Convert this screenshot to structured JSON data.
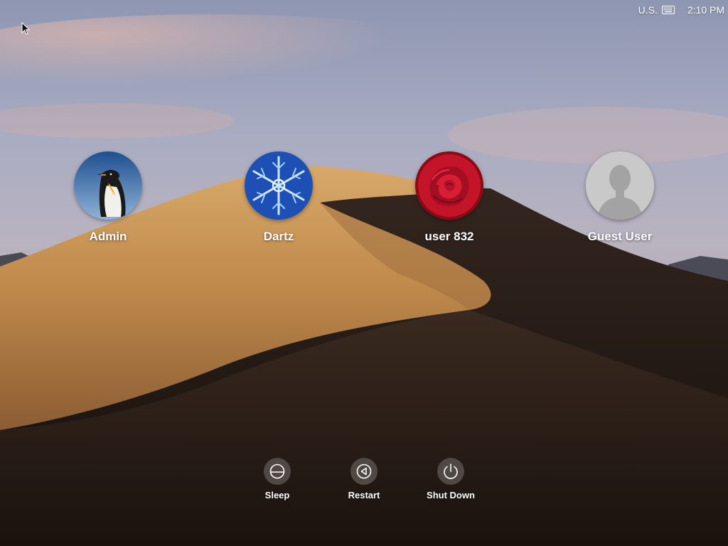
{
  "menubar": {
    "input_source": "U.S.",
    "input_source_icon": "keyboard-icon",
    "clock": "2:10 PM"
  },
  "users": [
    {
      "name": "Admin",
      "avatar": "penguin-avatar"
    },
    {
      "name": "Dartz",
      "avatar": "snowflake-avatar"
    },
    {
      "name": "user 832",
      "avatar": "rose-avatar"
    },
    {
      "name": "Guest User",
      "avatar": "generic-silhouette-avatar"
    }
  ],
  "power": {
    "sleep_label": "Sleep",
    "restart_label": "Restart",
    "shutdown_label": "Shut Down"
  },
  "colors": {
    "sky_top": "#8c93ad",
    "dune_light": "#c99a5c",
    "dune_shadow": "#1e1612",
    "text": "#ffffff",
    "button_bg": "#5f5854"
  }
}
